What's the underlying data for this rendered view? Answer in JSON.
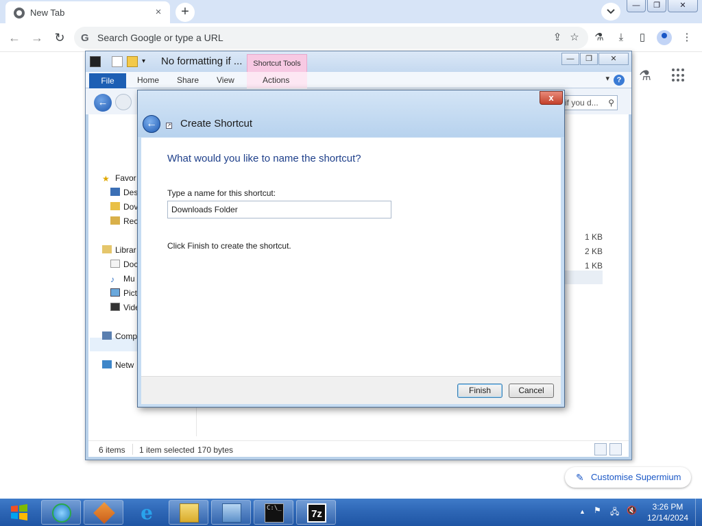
{
  "browser": {
    "tab_title": "New Tab",
    "tab_close": "×",
    "new_tab": "+",
    "omnibox_placeholder": "Search Google or type a URL",
    "customise_label": "Customise Supermium"
  },
  "explorer": {
    "title": "No formatting if ...",
    "contextual_tab_group": "Shortcut Tools",
    "ribbon_tabs": [
      "File",
      "Home",
      "Share",
      "View",
      "Actions"
    ],
    "search_placeholder": "if you d...",
    "nav_items": [
      {
        "label": "Favor",
        "icon": "star-icon"
      },
      {
        "label": "Des",
        "icon": "desktop-icon"
      },
      {
        "label": "Dov",
        "icon": "downloads-icon"
      },
      {
        "label": "Rec",
        "icon": "recent-icon"
      },
      {
        "label": "Librar",
        "icon": "library-icon"
      },
      {
        "label": "Doc",
        "icon": "documents-icon"
      },
      {
        "label": "Mu",
        "icon": "music-icon"
      },
      {
        "label": "Pict",
        "icon": "pictures-icon"
      },
      {
        "label": "Vide",
        "icon": "videos-icon"
      },
      {
        "label": "Comp",
        "icon": "computer-icon"
      },
      {
        "label": "Netw",
        "icon": "network-icon"
      }
    ],
    "file_sizes": [
      "1 KB",
      "2 KB",
      "1 KB"
    ],
    "status": {
      "items": "6 items",
      "selected": "1 item selected",
      "size": "170 bytes"
    }
  },
  "dialog": {
    "window_title": "Create Shortcut",
    "heading": "What would you like to name the shortcut?",
    "field_label": "Type a name for this shortcut:",
    "field_value": "Downloads Folder",
    "note": "Click Finish to create the shortcut.",
    "finish_label": "Finish",
    "cancel_label": "Cancel",
    "close_glyph": "x"
  },
  "taskbar": {
    "time": "3:26 PM",
    "date": "12/14/2024",
    "pinned": [
      "browser-icon",
      "app-icon",
      "internet-explorer-icon",
      "file-explorer-icon",
      "network-share-icon",
      "command-prompt-icon",
      "7zip-icon"
    ]
  },
  "colors": {
    "taskbar_blue": "#2e67b6",
    "dialog_heading": "#1e3f8a",
    "file_tab": "#1d5fb4",
    "contextual_tab": "#f7c9e3",
    "close_red": "#c3412b"
  }
}
